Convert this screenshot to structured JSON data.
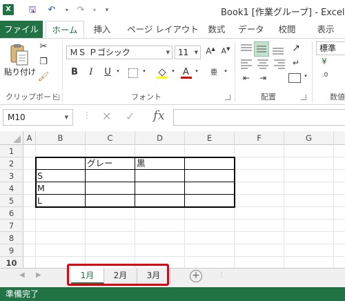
{
  "titlebar": {
    "logo_text": "X",
    "window_title": "Book1  [作業グループ] - Excel"
  },
  "ribbon_tabs": [
    "ファイル",
    "ホーム",
    "挿入",
    "ページ レイアウト",
    "数式",
    "データ",
    "校閲",
    "表示"
  ],
  "ribbon": {
    "paste_label": "貼り付け",
    "font_name": "ＭＳ Ｐゴシック",
    "font_size": "11",
    "number_format": "標準",
    "groups": {
      "clipboard": "クリップボード",
      "font": "フォント",
      "alignment": "配置",
      "number": "数値"
    }
  },
  "formula_bar": {
    "name_box": "M10",
    "fx": "fx",
    "formula": ""
  },
  "grid": {
    "columns": [
      "A",
      "B",
      "C",
      "D",
      "E",
      "F",
      "G"
    ],
    "rows": [
      "1",
      "2",
      "3",
      "4",
      "5",
      "6",
      "7",
      "8",
      "9",
      "10"
    ],
    "cells": {
      "C2": "グレー",
      "D2": "黒",
      "B3": "S",
      "B4": "M",
      "B5": "L"
    }
  },
  "sheets": [
    "1月",
    "2月",
    "3月"
  ],
  "active_sheet": "1月",
  "status": "準備完了",
  "colors": {
    "excel_green": "#217346",
    "highlight_red": "#e3000f"
  }
}
